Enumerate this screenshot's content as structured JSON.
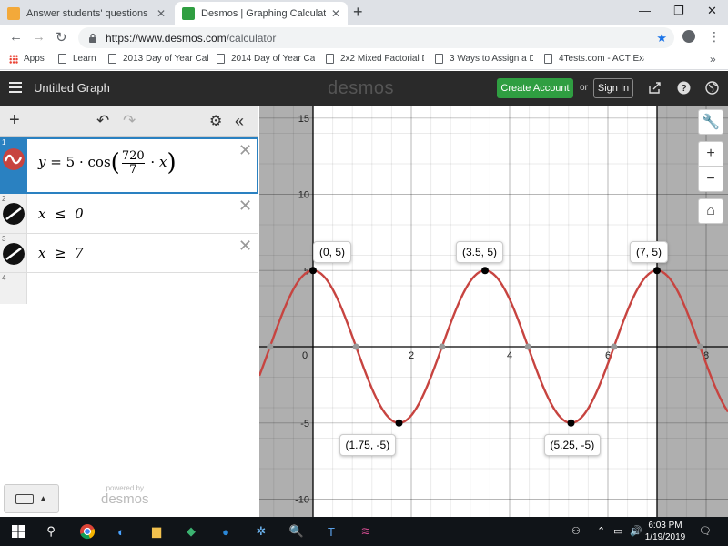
{
  "browser": {
    "tabs": [
      {
        "title": "Answer students' questions and l",
        "active": false
      },
      {
        "title": "Desmos | Graphing Calculator",
        "active": true
      }
    ],
    "new_tab": "+",
    "url_base": "https://www.desmos.com",
    "url_path": "/calculator",
    "bookmarks": [
      {
        "label": "Apps"
      },
      {
        "label": "Learn"
      },
      {
        "label": "2013 Day of Year Calc"
      },
      {
        "label": "2014 Day of Year Calc"
      },
      {
        "label": "2x2 Mixed Factorial D"
      },
      {
        "label": "3 Ways to Assign a D"
      },
      {
        "label": "4Tests.com - ACT Exa"
      }
    ],
    "bookmarks_more": "»"
  },
  "header": {
    "graph_title": "Untitled Graph",
    "logo": "desmos",
    "create_account": "Create Account",
    "or": "or",
    "sign_in": "Sign In"
  },
  "expressions": [
    {
      "num": "1",
      "color": "#c74440",
      "lhs": "y",
      "eq": "=",
      "coef": "5",
      "dot": "·",
      "fn": "cos",
      "frac_num": "720",
      "frac_den": "7",
      "var": "x"
    },
    {
      "num": "2",
      "color": "#000000",
      "text": "x  ≤  0"
    },
    {
      "num": "3",
      "color": "#000000",
      "text": "x  ≥  7"
    },
    {
      "num": "4"
    }
  ],
  "footer": {
    "powered_by": "powered by",
    "powered_logo": "desmos"
  },
  "graph": {
    "x_ticks": [
      "0",
      "2",
      "4",
      "6",
      "8"
    ],
    "y_ticks": [
      "15",
      "10",
      "5",
      "-5",
      "-10"
    ],
    "curve_color": "#c74440",
    "points": [
      {
        "label": "(0, 5)",
        "x": 0,
        "y": 5
      },
      {
        "label": "(3.5, 5)",
        "x": 3.5,
        "y": 5
      },
      {
        "label": "(7, 5)",
        "x": 7,
        "y": 5
      },
      {
        "label": "(1.75, -5)",
        "x": 1.75,
        "y": -5
      },
      {
        "label": "(5.25, -5)",
        "x": 5.25,
        "y": -5
      }
    ]
  },
  "taskbar": {
    "time": "6:03 PM",
    "date": "1/19/2019"
  }
}
